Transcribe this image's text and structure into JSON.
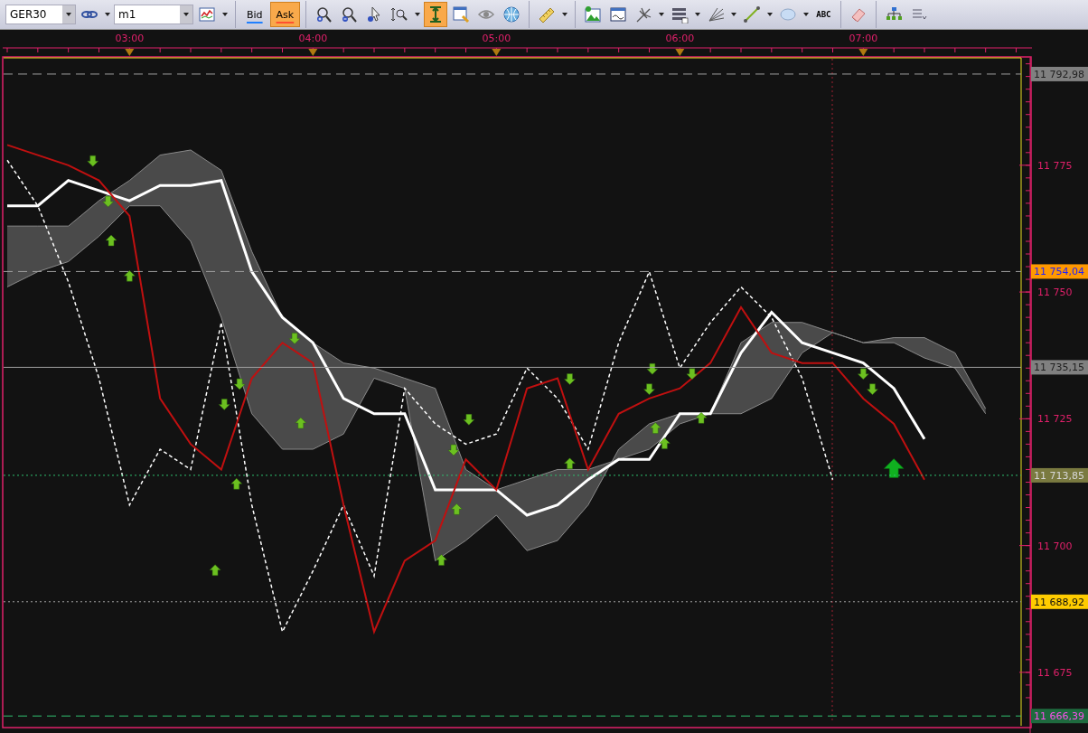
{
  "toolbar": [
    {
      "kind": "combo",
      "value": "GER30"
    },
    {
      "kind": "icon",
      "dropdown": true,
      "selected": false
    },
    {
      "kind": "combo",
      "value": "m1"
    },
    {
      "kind": "icon",
      "dropdown": true,
      "selected": false
    },
    {
      "kind": "separator"
    },
    {
      "kind": "text",
      "label": "Bid",
      "selected": false
    },
    {
      "kind": "text",
      "label": "Ask",
      "selected": true
    },
    {
      "kind": "separator"
    },
    {
      "kind": "icon",
      "dropdown": false,
      "selected": false
    },
    {
      "kind": "icon",
      "dropdown": false,
      "selected": false
    },
    {
      "kind": "icon",
      "dropdown": false,
      "selected": false
    },
    {
      "kind": "icon",
      "dropdown": true,
      "selected": false
    },
    {
      "kind": "icon",
      "dropdown": false,
      "selected": true
    },
    {
      "kind": "icon",
      "dropdown": false,
      "selected": false
    },
    {
      "kind": "icon",
      "dropdown": false,
      "selected": false
    },
    {
      "kind": "icon",
      "dropdown": false,
      "selected": false
    },
    {
      "kind": "separator"
    },
    {
      "kind": "icon",
      "dropdown": true,
      "selected": false
    },
    {
      "kind": "separator"
    },
    {
      "kind": "icon",
      "dropdown": false,
      "selected": false
    },
    {
      "kind": "icon",
      "dropdown": false,
      "selected": false
    },
    {
      "kind": "icon",
      "dropdown": true,
      "selected": false
    },
    {
      "kind": "icon",
      "dropdown": true,
      "selected": false
    },
    {
      "kind": "icon",
      "dropdown": true,
      "selected": false
    },
    {
      "kind": "icon",
      "dropdown": true,
      "selected": false
    },
    {
      "kind": "icon",
      "dropdown": true,
      "selected": false
    },
    {
      "kind": "text_icon",
      "label": "ABC"
    },
    {
      "kind": "separator"
    },
    {
      "kind": "icon",
      "dropdown": false,
      "selected": false
    },
    {
      "kind": "separator"
    },
    {
      "kind": "icon",
      "dropdown": false,
      "selected": false
    },
    {
      "kind": "icon",
      "dropdown": false,
      "selected": false
    }
  ],
  "chart": {
    "chart_data": {
      "type": "line",
      "ylim": [
        11665,
        11796
      ],
      "categories": [
        null,
        null,
        null,
        null,
        "03:00",
        null,
        null,
        null,
        null,
        null,
        "04:00",
        null,
        null,
        null,
        null,
        null,
        "05:00",
        null,
        null,
        null,
        null,
        null,
        "06:00",
        null,
        null,
        null,
        null,
        null,
        "07:00",
        null,
        null,
        null,
        null
      ],
      "yticks": [
        {
          "value": 11675,
          "label": "11 675"
        },
        {
          "value": 11700,
          "label": "11 700"
        },
        {
          "value": 11725,
          "label": "11 725"
        },
        {
          "value": 11750,
          "label": "11 750"
        },
        {
          "value": 11775,
          "label": "11 775"
        }
      ],
      "series": [
        {
          "color": "#8a8a8a",
          "values": [
            11763,
            11763,
            11763,
            11768,
            11772,
            11777,
            11778,
            11774,
            11758,
            11745,
            11740,
            11736,
            11735,
            11733,
            11731,
            11715,
            11711,
            11713,
            11715,
            11715,
            11717,
            11719,
            11724,
            11726,
            11740,
            11744,
            11744,
            11742,
            11740,
            11741,
            11741,
            11738,
            11727
          ]
        },
        {
          "color": "#8a8a8a",
          "values": [
            11751,
            11754,
            11756,
            11761,
            11767,
            11767,
            11760,
            11745,
            11726,
            11719,
            11719,
            11722,
            11733,
            11731,
            11697,
            11701,
            11706,
            11699,
            11701,
            11708,
            11719,
            11724,
            11726,
            11726,
            11726,
            11729,
            11738,
            11742,
            11740,
            11740,
            11737,
            11735,
            11726
          ]
        },
        {
          "color": "#ffffff",
          "values": [
            11767,
            11767,
            11772,
            11770,
            11768,
            11771,
            11771,
            11772,
            11754,
            11745,
            11740,
            11729,
            11726,
            11726,
            11711,
            11711,
            11711,
            11706,
            11708,
            11713,
            11717,
            11717,
            11726,
            11726,
            11738,
            11746,
            11740,
            11738,
            11736,
            11731,
            11721,
            null,
            null
          ]
        },
        {
          "color": "#ffffff",
          "line_style": "dashed",
          "values": [
            11776,
            11767,
            11752,
            11733,
            11708,
            11719,
            11715,
            11744,
            11708,
            11683,
            11695,
            11708,
            11694,
            11731,
            11724,
            11720,
            11722,
            11735,
            11729,
            11719,
            11740,
            11754,
            11735,
            11744,
            11751,
            11745,
            11733,
            11713,
            null,
            null,
            null,
            null,
            null
          ]
        },
        {
          "color": "#c01010",
          "values": [
            11779,
            11777,
            11775,
            11772,
            11765,
            11729,
            11720,
            11715,
            11733,
            11740,
            11736,
            11708,
            11683,
            11697,
            11701,
            11717,
            11711,
            11731,
            11733,
            11715,
            11726,
            11729,
            11731,
            11736,
            11747,
            11738,
            11736,
            11736,
            11729,
            11724,
            11713,
            null,
            null
          ]
        }
      ],
      "ref_lines": [
        {
          "axis": "y",
          "value": 11792.98,
          "label": "11 792,98",
          "color": "#a0a0a0"
        },
        {
          "axis": "y",
          "value": 11754.04,
          "label": "11 754,04",
          "color": "#a0a0a0"
        },
        {
          "axis": "y",
          "value": 11735.15,
          "label": "11 735,15",
          "color": "#a0a0a0"
        },
        {
          "axis": "y",
          "value": 11713.85,
          "label": "11 713,85",
          "color": "#30c070"
        },
        {
          "axis": "y",
          "value": 11688.92,
          "label": "11 688,92",
          "color": "#a0a0a0"
        },
        {
          "axis": "y",
          "value": 11666.39,
          "label": "11 666,39",
          "color": "#30c070"
        }
      ]
    }
  }
}
